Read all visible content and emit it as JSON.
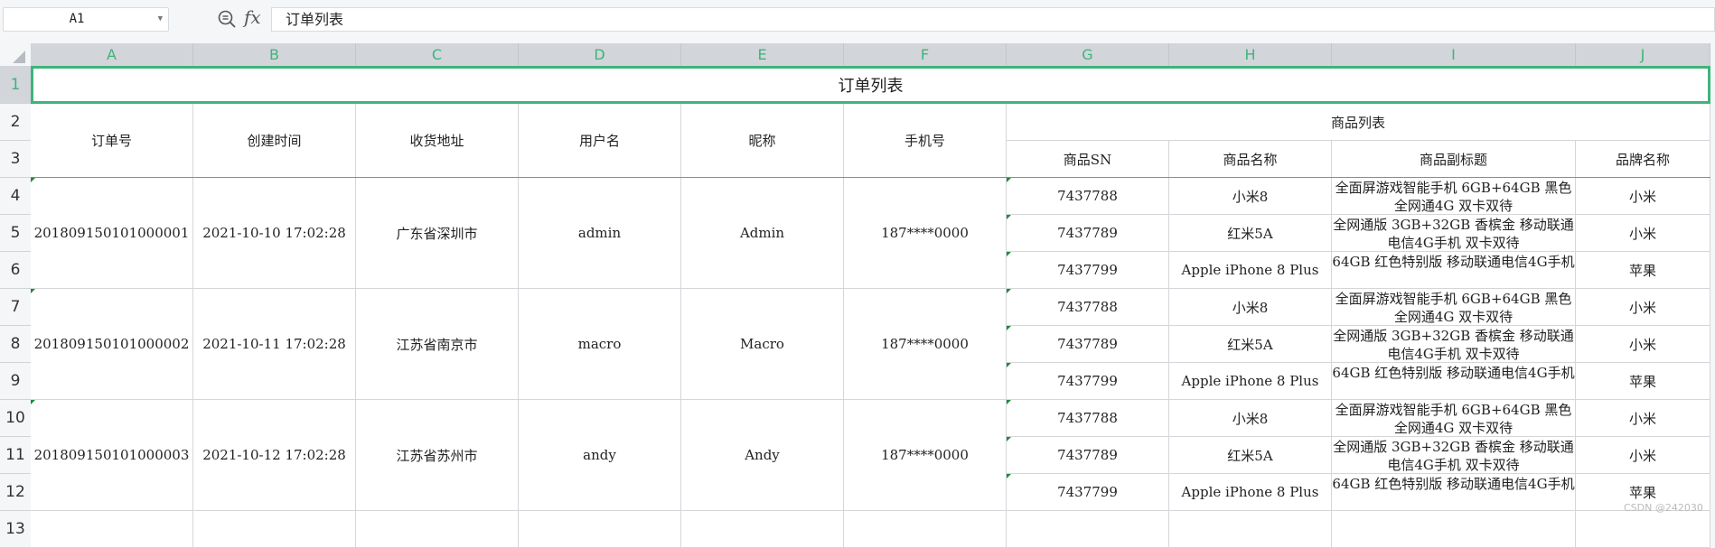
{
  "toolbar": {
    "name_box": "A1",
    "formula_label": "fx",
    "formula_value": "订单列表"
  },
  "columns": [
    "A",
    "B",
    "C",
    "D",
    "E",
    "F",
    "G",
    "H",
    "I",
    "J"
  ],
  "rows": [
    "1",
    "2",
    "3",
    "4",
    "5",
    "6",
    "7",
    "8",
    "9",
    "10",
    "11",
    "12",
    "13"
  ],
  "sheet": {
    "title": "订单列表",
    "headers": {
      "order_no": "订单号",
      "created": "创建时间",
      "address": "收货地址",
      "username": "用户名",
      "nickname": "昵称",
      "phone": "手机号",
      "product_group": "商品列表",
      "product_sn": "商品SN",
      "product_name": "商品名称",
      "product_subtitle": "商品副标题",
      "brand": "品牌名称"
    },
    "orders": [
      {
        "order_no": "201809150101000001",
        "created": "2021-10-10 17:02:28",
        "address": "广东省深圳市",
        "username": "admin",
        "nickname": "Admin",
        "phone": "187****0000",
        "products": [
          {
            "sn": "7437788",
            "name": "小米8",
            "subtitle": "全面屏游戏智能手机 6GB+64GB 黑色 全网通4G 双卡双待",
            "brand": "小米"
          },
          {
            "sn": "7437789",
            "name": "红米5A",
            "subtitle": "全网通版 3GB+32GB 香槟金 移动联通电信4G手机 双卡双待",
            "brand": "小米"
          },
          {
            "sn": "7437799",
            "name": "Apple iPhone 8 Plus",
            "subtitle": "64GB 红色特别版 移动联通电信4G手机",
            "brand": "苹果"
          }
        ]
      },
      {
        "order_no": "201809150101000002",
        "created": "2021-10-11 17:02:28",
        "address": "江苏省南京市",
        "username": "macro",
        "nickname": "Macro",
        "phone": "187****0000",
        "products": [
          {
            "sn": "7437788",
            "name": "小米8",
            "subtitle": "全面屏游戏智能手机 6GB+64GB 黑色 全网通4G 双卡双待",
            "brand": "小米"
          },
          {
            "sn": "7437789",
            "name": "红米5A",
            "subtitle": "全网通版 3GB+32GB 香槟金 移动联通电信4G手机 双卡双待",
            "brand": "小米"
          },
          {
            "sn": "7437799",
            "name": "Apple iPhone 8 Plus",
            "subtitle": "64GB 红色特别版 移动联通电信4G手机",
            "brand": "苹果"
          }
        ]
      },
      {
        "order_no": "201809150101000003",
        "created": "2021-10-12 17:02:28",
        "address": "江苏省苏州市",
        "username": "andy",
        "nickname": "Andy",
        "phone": "187****0000",
        "products": [
          {
            "sn": "7437788",
            "name": "小米8",
            "subtitle": "全面屏游戏智能手机 6GB+64GB 黑色 全网通4G 双卡双待",
            "brand": "小米"
          },
          {
            "sn": "7437789",
            "name": "红米5A",
            "subtitle": "全网通版 3GB+32GB 香槟金 移动联通电信4G手机 双卡双待",
            "brand": "小米"
          },
          {
            "sn": "7437799",
            "name": "Apple iPhone 8 Plus",
            "subtitle": "64GB 红色特别版 移动联通电信4G手机",
            "brand": "苹果"
          }
        ]
      }
    ]
  },
  "watermark": "CSDN @242030",
  "colors": {
    "accent": "#3fb47a",
    "header_bg": "#d2d5da"
  }
}
